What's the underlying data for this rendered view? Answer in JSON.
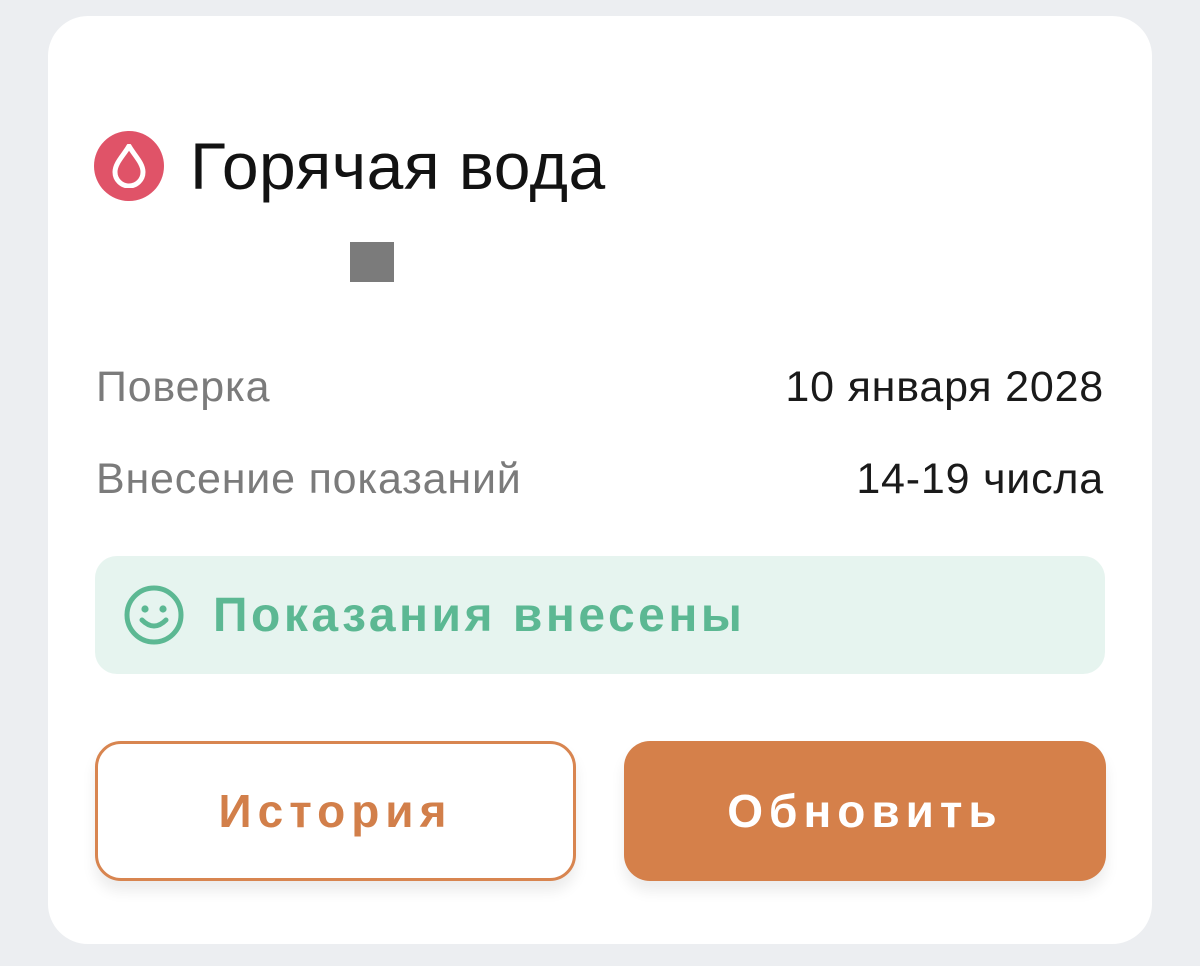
{
  "meter": {
    "title": "Горячая вода",
    "icon": "water-drop-icon",
    "icon_color": "#e05368"
  },
  "details": [
    {
      "label": "Поверка",
      "value": "10 января 2028"
    },
    {
      "label": "Внесение показаний",
      "value": "14-19 числа"
    }
  ],
  "status": {
    "text": "Показания внесены",
    "icon": "smile-icon",
    "color": "#5cb893",
    "background": "#e6f4ef"
  },
  "buttons": {
    "history_label": "История",
    "update_label": "Обновить"
  },
  "colors": {
    "accent": "#d5804a",
    "page_background": "#eceef1"
  }
}
